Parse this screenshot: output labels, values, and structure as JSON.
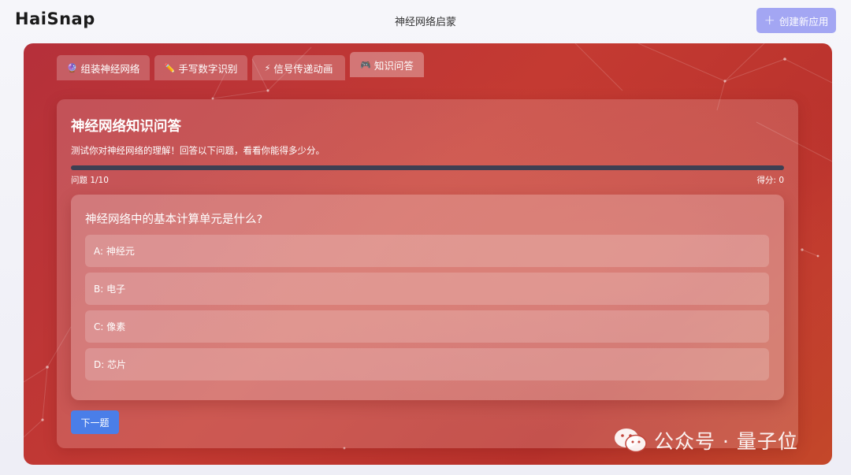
{
  "app": {
    "logo": "HaiSnap",
    "title": "神经网络启蒙",
    "create_button": "创建新应用"
  },
  "tabs": [
    {
      "icon": "🔮",
      "label": "组装神经网络",
      "active": false
    },
    {
      "icon": "✏️",
      "label": "手写数字识别",
      "active": false
    },
    {
      "icon": "⚡",
      "label": "信号传递动画",
      "active": false
    },
    {
      "icon": "🎮",
      "label": "知识问答",
      "active": true
    }
  ],
  "quiz": {
    "title": "神经网络知识问答",
    "description": "测试你对神经网络的理解！回答以下问题，看看你能得多少分。",
    "progress": 0,
    "counter": "问题 1/10",
    "score": "得分: 0",
    "question": "神经网络中的基本计算单元是什么?",
    "options": [
      "A: 神经元",
      "B: 电子",
      "C: 像素",
      "D: 芯片"
    ],
    "next_button": "下一题"
  },
  "watermark": {
    "text": "公众号 · 量子位"
  },
  "colors": {
    "accent": "#a3a6f3",
    "panel_red": "#c03832",
    "progress_track": "#3e3f52",
    "next_button": "#4a7ee8"
  }
}
